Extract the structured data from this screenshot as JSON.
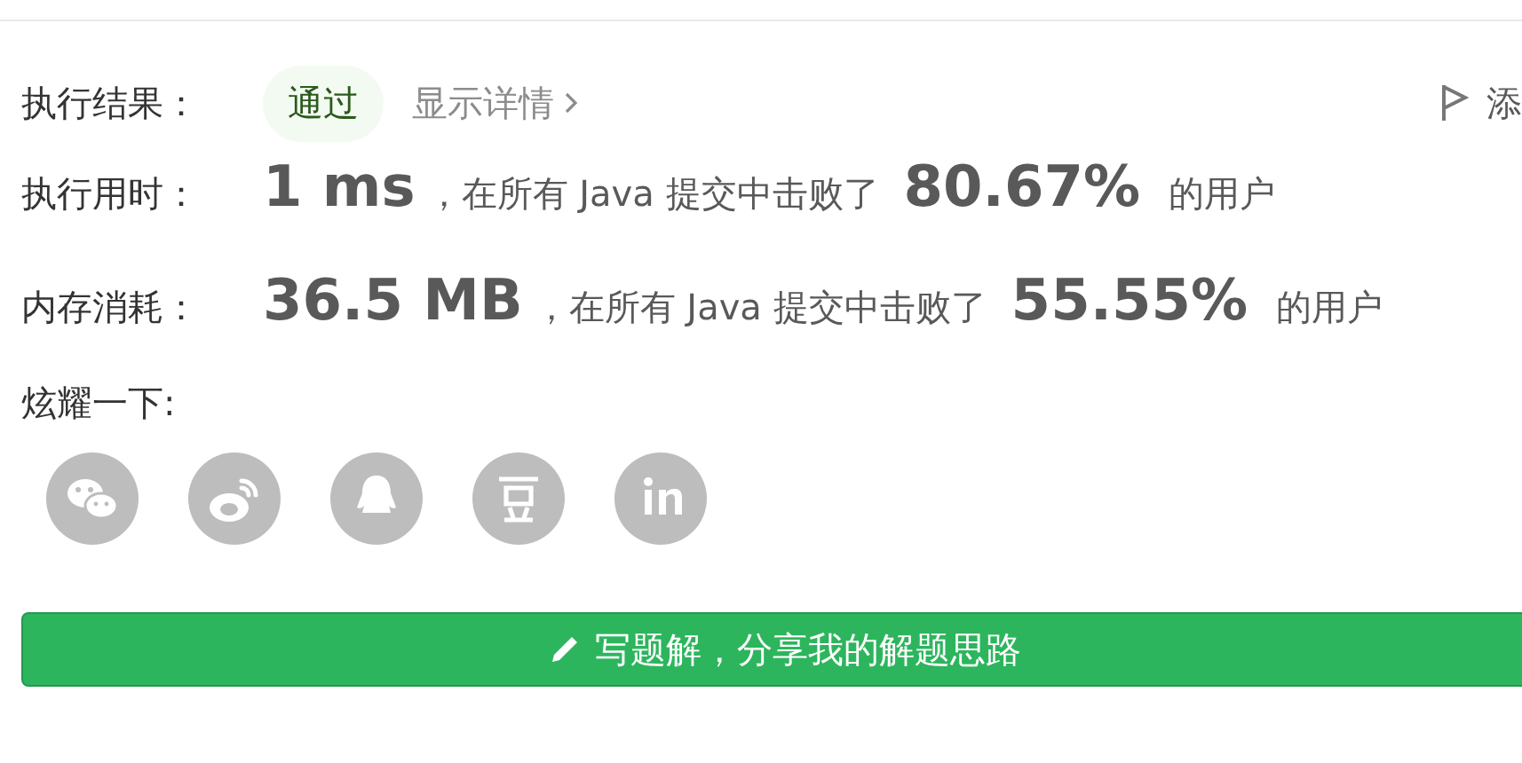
{
  "result": {
    "label": "执行结果：",
    "status": "通过",
    "details_link": "显示详情",
    "flag_action": "添"
  },
  "stats": [
    {
      "label": "执行用时：",
      "value": "1 ms",
      "prefix": "，在所有 Java 提交中击败了",
      "percent": "80.67%",
      "suffix": "的用户"
    },
    {
      "label": "内存消耗：",
      "value": "36.5 MB",
      "prefix": "，在所有 Java 提交中击败了",
      "percent": "55.55%",
      "suffix": "的用户"
    }
  ],
  "share": {
    "label": "炫耀一下:",
    "icons": [
      {
        "kind": "wechat"
      },
      {
        "kind": "weibo"
      },
      {
        "kind": "qq"
      },
      {
        "kind": "douban"
      },
      {
        "kind": "linkedin"
      }
    ]
  },
  "write_button": {
    "label": "写题解，分享我的解题思路"
  }
}
